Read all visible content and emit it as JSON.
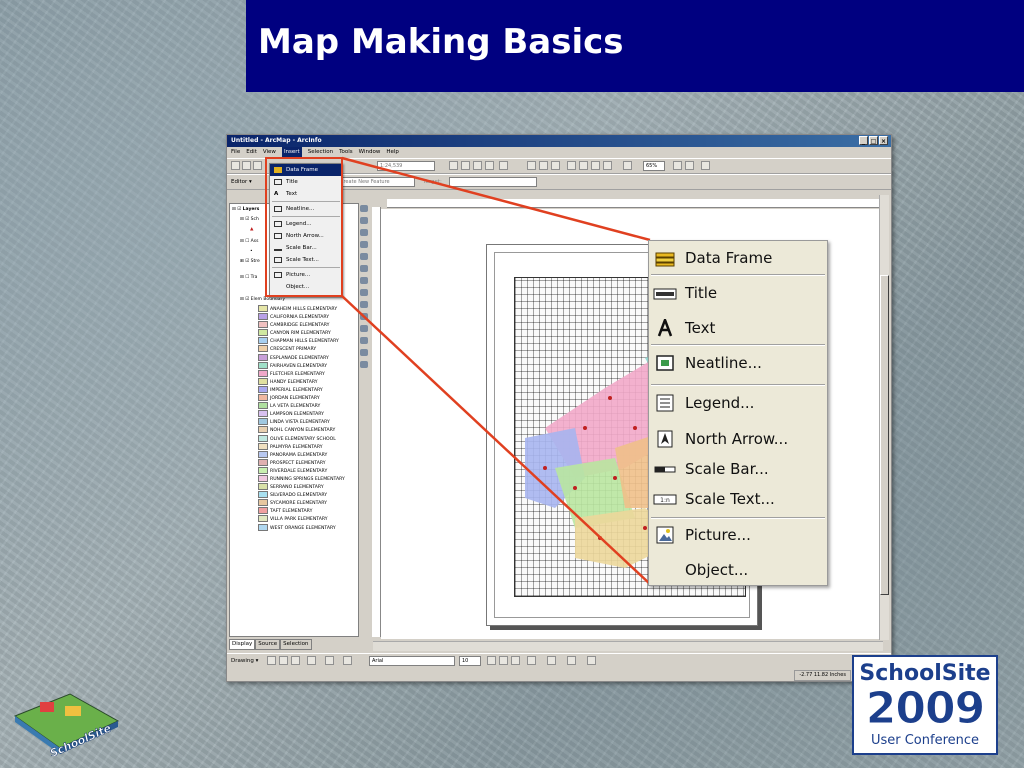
{
  "slide": {
    "title": "Map Making Basics"
  },
  "window": {
    "caption": "Untitled - ArcMap - ArcInfo",
    "controls": [
      "_",
      "□",
      "×"
    ],
    "menus": [
      "File",
      "Edit",
      "View",
      "Insert",
      "Selection",
      "Tools",
      "Window",
      "Help"
    ],
    "active_menu": "Insert",
    "scale": "1:24,539",
    "zoom": "65%",
    "editor_label": "Editor ▾",
    "task_field": "Create New Feature",
    "target_label": "Target:",
    "toc_tabs": [
      "Display",
      "Source",
      "Selection"
    ],
    "toc_layers": [
      {
        "label": "Layers",
        "checked": true
      },
      {
        "label": "Sch",
        "checked": true
      },
      {
        "label": "Ass",
        "checked": false
      },
      {
        "label": "Stre",
        "checked": true
      },
      {
        "label": "Tra",
        "checked": false
      },
      {
        "label": "Elem Boundary",
        "checked": true
      }
    ],
    "legend": [
      {
        "name": "ANAHEIM HILLS ELEMENTARY",
        "color": "#e6e6a8"
      },
      {
        "name": "CALIFORNIA ELEMENTARY",
        "color": "#b8a0e6"
      },
      {
        "name": "CAMBRIDGE ELEMENTARY",
        "color": "#f0c0c0"
      },
      {
        "name": "CANYON RIM ELEMENTARY",
        "color": "#d0e8a0"
      },
      {
        "name": "CHAPMAN HILLS ELEMENTARY",
        "color": "#a8d0f0"
      },
      {
        "name": "CRESCENT PRIMARY",
        "color": "#f0d0a8"
      },
      {
        "name": "ESPLANADE ELEMENTARY",
        "color": "#c8a0d8"
      },
      {
        "name": "FAIRHAVEN ELEMENTARY",
        "color": "#a0e0c8"
      },
      {
        "name": "FLETCHER ELEMENTARY",
        "color": "#f0a8c8"
      },
      {
        "name": "HANDY ELEMENTARY",
        "color": "#e0e0a0"
      },
      {
        "name": "IMPERIAL ELEMENTARY",
        "color": "#a8a8f0"
      },
      {
        "name": "JORDAN ELEMENTARY",
        "color": "#f0b8a0"
      },
      {
        "name": "LA VETA ELEMENTARY",
        "color": "#b0e0a0"
      },
      {
        "name": "LAMPSON ELEMENTARY",
        "color": "#d8c0f0"
      },
      {
        "name": "LINDA VISTA ELEMENTARY",
        "color": "#a0c8e0"
      },
      {
        "name": "NOHL CANYON ELEMENTARY",
        "color": "#e8d0b0"
      },
      {
        "name": "OLIVE ELEMENTARY SCHOOL",
        "color": "#c0e8e0"
      },
      {
        "name": "PALMYRA ELEMENTARY",
        "color": "#f0e0c0"
      },
      {
        "name": "PANORAMA ELEMENTARY",
        "color": "#b8c8f0"
      },
      {
        "name": "PROSPECT ELEMENTARY",
        "color": "#e0b0b0"
      },
      {
        "name": "RIVERDALE ELEMENTARY",
        "color": "#c8f0b0"
      },
      {
        "name": "RUNNING SPRINGS ELEMENTARY",
        "color": "#f0c8e0"
      },
      {
        "name": "SERRANO ELEMENTARY",
        "color": "#d8e0a8"
      },
      {
        "name": "SILVERADO ELEMENTARY",
        "color": "#a8e0f0"
      },
      {
        "name": "SYCAMORE ELEMENTARY",
        "color": "#e8c8a0"
      },
      {
        "name": "TAFT ELEMENTARY",
        "color": "#f0a0a0"
      },
      {
        "name": "VILLA PARK ELEMENTARY",
        "color": "#e0e8c0"
      },
      {
        "name": "WEST ORANGE ELEMENTARY",
        "color": "#b0d8f0"
      }
    ],
    "font_name": "Arial",
    "font_size": "10",
    "drawing_label": "Drawing ▾",
    "coordinates": "-2.77  11.82 Inches"
  },
  "insert_menu": [
    {
      "label": "Data Frame",
      "icon": "data-frame-icon"
    },
    {
      "label": "Title",
      "icon": "title-icon"
    },
    {
      "label": "Text",
      "icon": "text-icon"
    },
    {
      "label": "Neatline...",
      "icon": "neatline-icon"
    },
    {
      "label": "Legend...",
      "icon": "legend-icon"
    },
    {
      "label": "North Arrow...",
      "icon": "north-arrow-icon"
    },
    {
      "label": "Scale Bar...",
      "icon": "scale-bar-icon"
    },
    {
      "label": "Scale Text...",
      "icon": "scale-text-icon"
    },
    {
      "label": "Picture...",
      "icon": "picture-icon"
    },
    {
      "label": "Object...",
      "icon": "object-icon"
    }
  ],
  "logos": {
    "left": "SchoolSite",
    "right_line1": "SchoolSite",
    "right_line2": "2009",
    "right_line3": "User Conference"
  },
  "colors": {
    "title_bar": "#000080",
    "callout_line": "#e04020",
    "menu_highlight": "#0a246a"
  }
}
